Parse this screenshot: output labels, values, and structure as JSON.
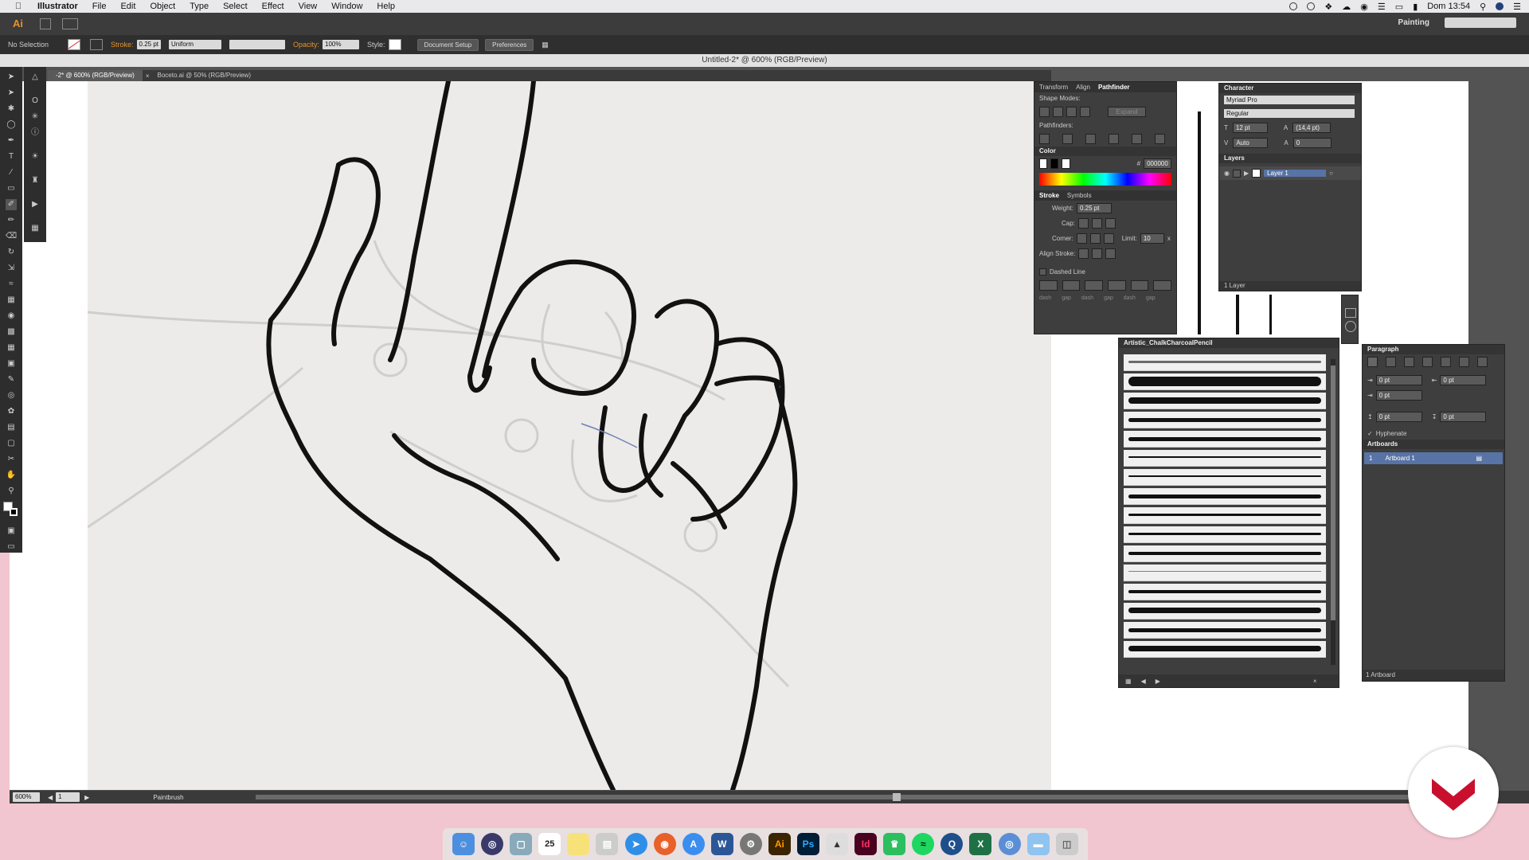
{
  "menubar": {
    "app": "Illustrator",
    "items": [
      "File",
      "Edit",
      "Object",
      "Type",
      "Select",
      "Effect",
      "View",
      "Window",
      "Help"
    ],
    "clock": "Dom 13:54"
  },
  "appbar": {
    "logo": "Ai",
    "workspace": "Painting"
  },
  "control": {
    "selection": "No Selection",
    "stroke_label": "Stroke:",
    "stroke_value": "0.25 pt",
    "profile": "Uniform",
    "opacity_label": "Opacity:",
    "opacity_value": "100%",
    "style_label": "Style:",
    "doc_setup": "Document Setup",
    "preferences": "Preferences"
  },
  "document": {
    "title": "Untitled-2* @ 600% (RGB/Preview)",
    "tabs": [
      {
        "label": "-2* @ 600% (RGB/Preview)",
        "active": true
      },
      {
        "label": "Boceto.ai @ 50% (RGB/Preview)",
        "active": false
      }
    ]
  },
  "status": {
    "zoom": "600%",
    "artboard": "1",
    "tool": "Paintbrush"
  },
  "pathfinder": {
    "tabs": [
      "Transform",
      "Align",
      "Pathfinder"
    ],
    "shape_modes": "Shape Modes:",
    "expand": "Expand",
    "pathfinders": "Pathfinders:"
  },
  "color": {
    "title": "Color",
    "hex_label": "#",
    "hex": "000000"
  },
  "stroke": {
    "tabs": [
      "Stroke",
      "Symbols"
    ],
    "weight_label": "Weight:",
    "weight": "0.25 pt",
    "cap_label": "Cap:",
    "corner_label": "Corner:",
    "limit_label": "Limit:",
    "limit": "10",
    "limit_unit": "x",
    "align_label": "Align Stroke:",
    "dashed": "Dashed Line",
    "dash_labels": [
      "dash",
      "gap",
      "dash",
      "gap",
      "dash",
      "gap"
    ]
  },
  "character": {
    "title": "Character",
    "font": "Myriad Pro",
    "style": "Regular",
    "size": "12 pt",
    "leading": "(14,4 pt)",
    "kerning": "Auto",
    "tracking": "0"
  },
  "layers": {
    "title": "Layers",
    "layer_name": "Layer 1",
    "count": "1 Layer"
  },
  "brushes": {
    "title": "Artistic_ChalkCharcoalPencil"
  },
  "paragraph": {
    "title": "Paragraph",
    "indent_left": "0 pt",
    "indent_right": "0 pt",
    "first_line": "0 pt",
    "space_before": "0 pt",
    "space_after": "0 pt",
    "hyphenate": "Hyphenate"
  },
  "artboards": {
    "title": "Artboards",
    "index": "1",
    "name": "Artboard 1",
    "count": "1 Artboard"
  },
  "dock": {
    "calendar_day": "25",
    "apps": [
      "finder",
      "siri",
      "preview",
      "calendar",
      "notes",
      "photos-app",
      "safari",
      "firefox",
      "app-store",
      "word",
      "system-preferences",
      "illustrator",
      "photoshop",
      "keynote",
      "indesign",
      "evernote",
      "spotify",
      "quicktime",
      "excel",
      "network",
      "folder",
      "trash"
    ],
    "labels": {
      "word": "W",
      "illustrator": "Ai",
      "photoshop": "Ps",
      "indesign": "Id",
      "excel": "X"
    }
  },
  "colors": {
    "accent": "#e8922a",
    "panel_bg": "#3e3e3e",
    "selected_row": "#5873a5",
    "watermark_red": "#c8102e",
    "desktop_pink": "#f2c6d0"
  }
}
